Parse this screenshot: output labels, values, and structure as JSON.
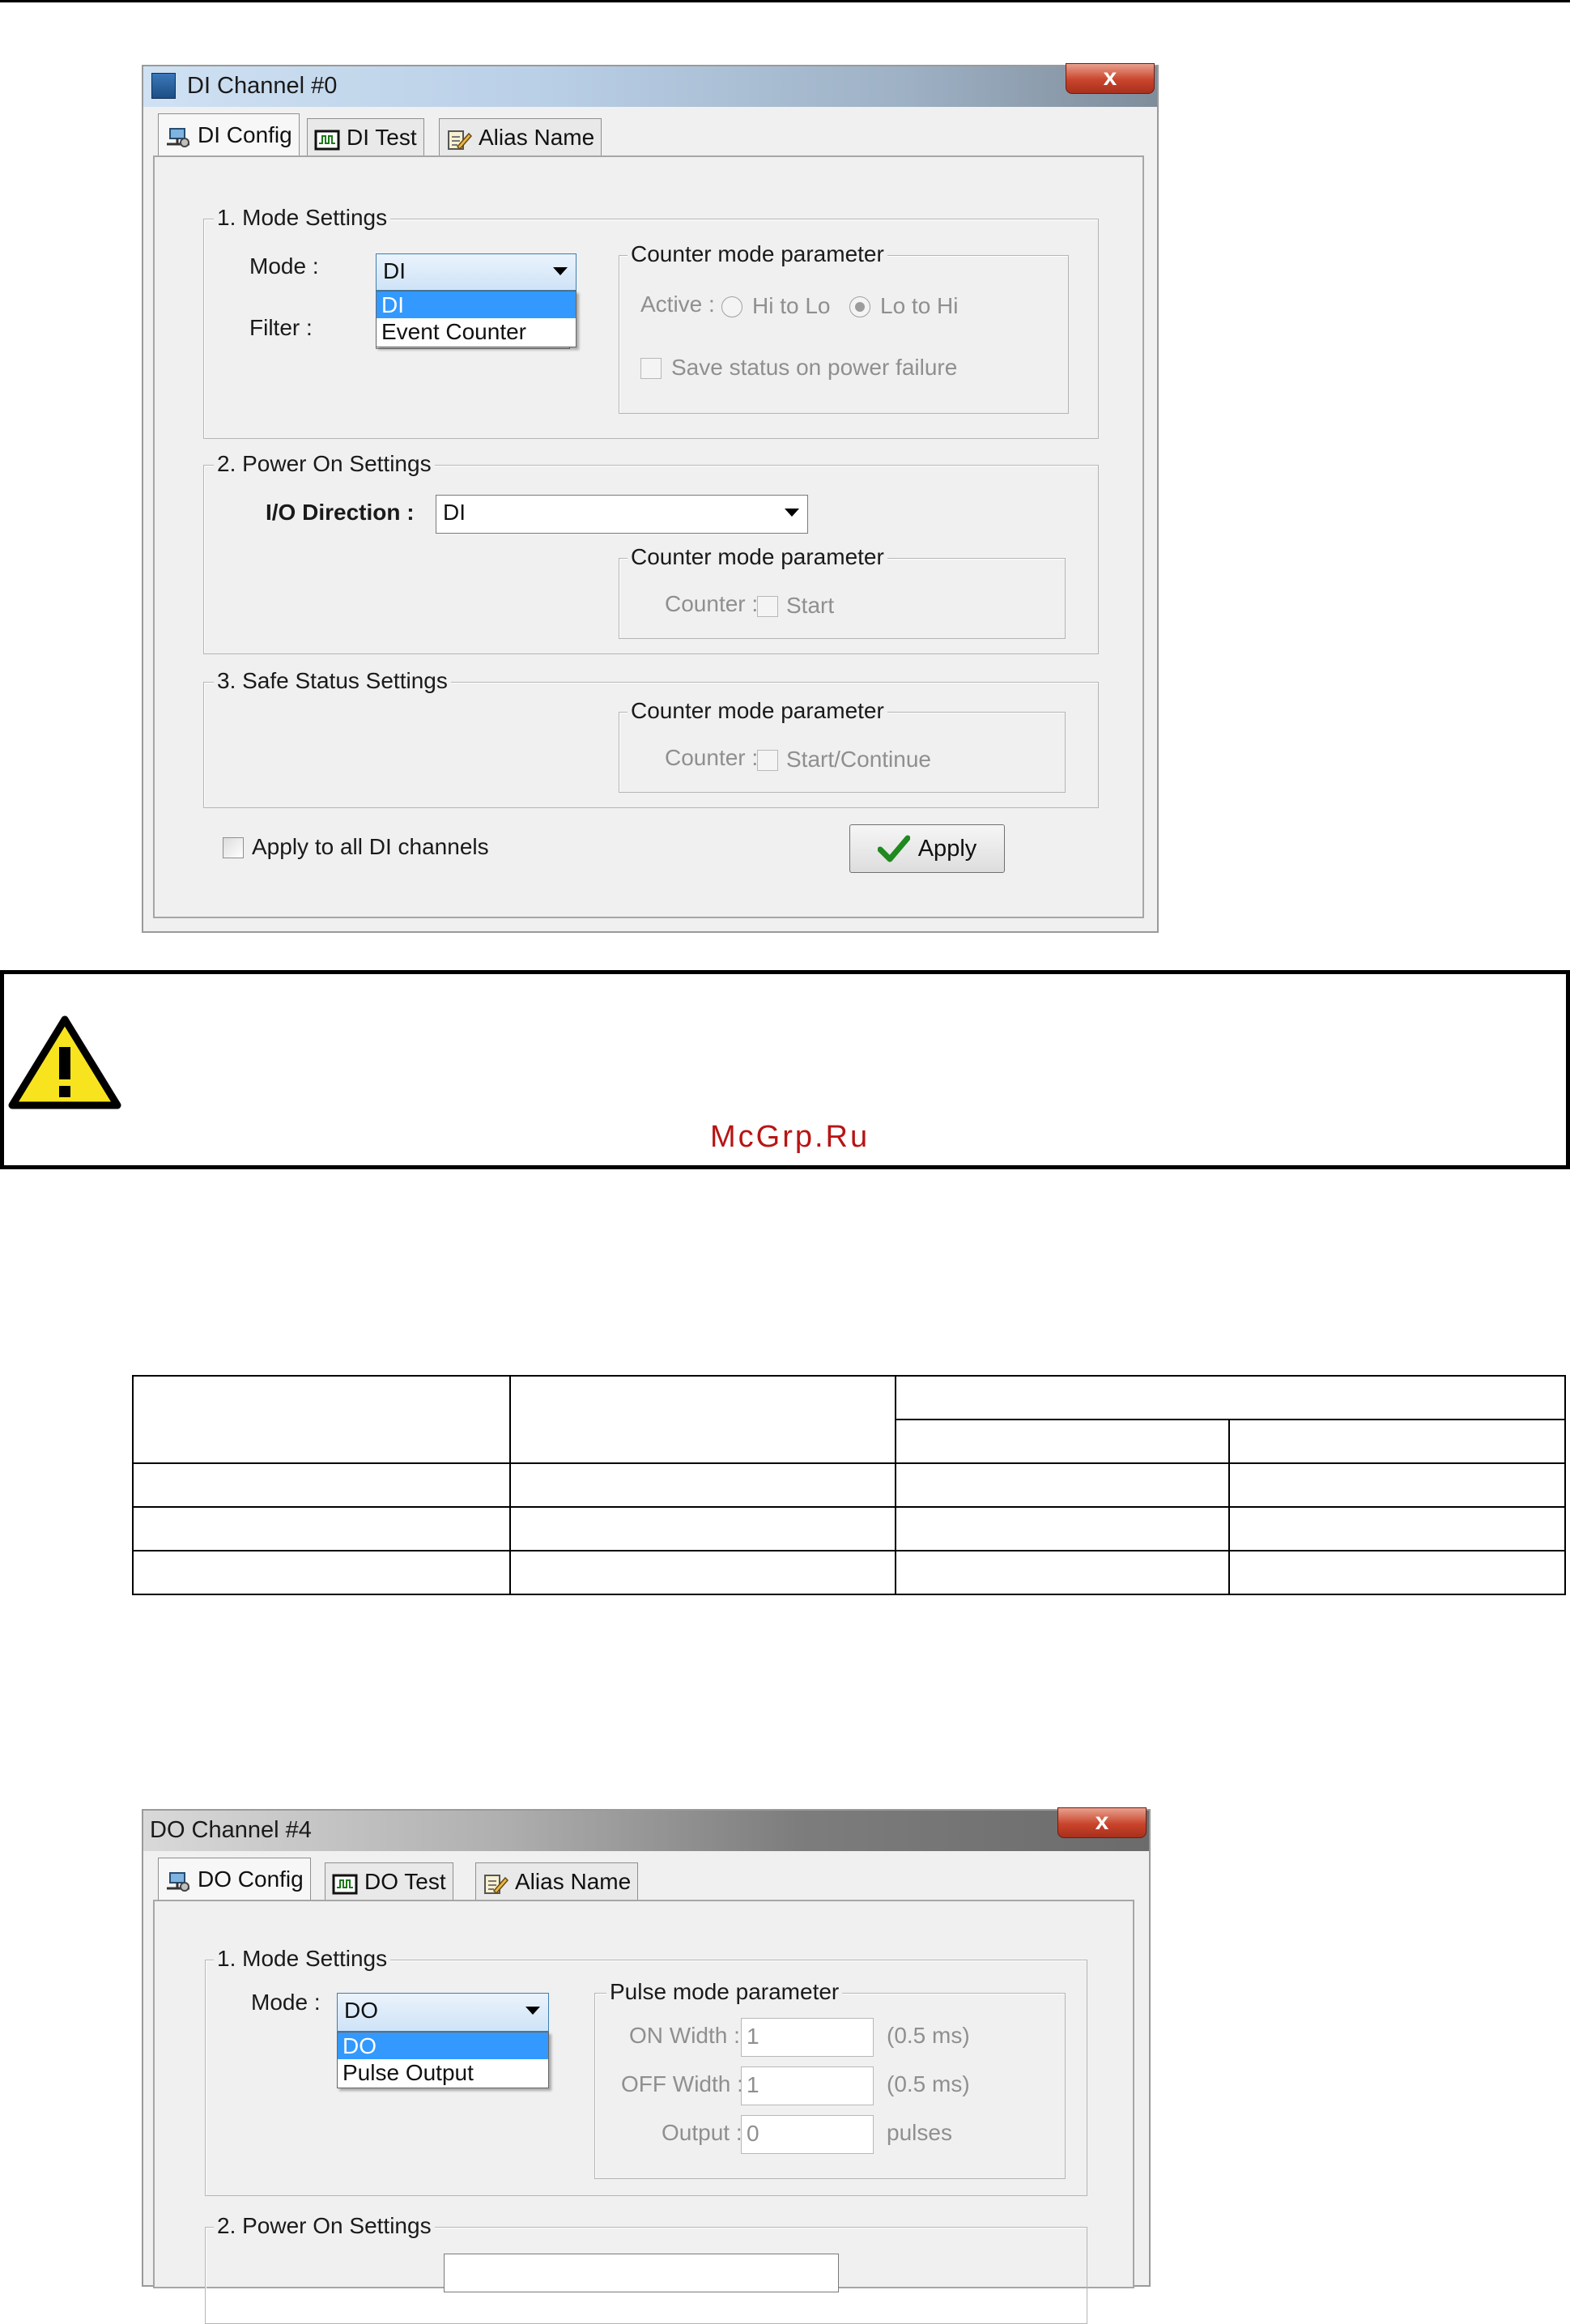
{
  "di_window": {
    "title": "DI Channel #0",
    "close_label": "x",
    "tabs": [
      {
        "label": "DI Config",
        "icon": "network-config-icon"
      },
      {
        "label": "DI Test",
        "icon": "oscilloscope-icon"
      },
      {
        "label": "Alias Name",
        "icon": "notepad-pencil-icon"
      }
    ],
    "mode_settings": {
      "legend": "1. Mode Settings",
      "mode_label": "Mode :",
      "mode_value": "DI",
      "mode_options": [
        "DI",
        "Event Counter"
      ],
      "filter_label": "Filter :",
      "counter_legend": "Counter mode parameter",
      "active_label": "Active :",
      "radio_hi_to_lo": "Hi to Lo",
      "radio_lo_to_hi": "Lo to Hi",
      "save_status": "Save status on power failure"
    },
    "power_on": {
      "legend": "2. Power On Settings",
      "io_direction_label": "I/O Direction :",
      "io_direction_value": "DI",
      "counter_legend": "Counter mode parameter",
      "counter_label": "Counter :",
      "start_label": "Start"
    },
    "safe_status": {
      "legend": "3. Safe Status Settings",
      "counter_legend": "Counter mode parameter",
      "counter_label": "Counter :",
      "start_continue_label": "Start/Continue"
    },
    "apply_all_label": "Apply to all DI channels",
    "apply_button": "Apply"
  },
  "warning": {
    "icon": "warning-triangle-icon",
    "watermark": "McGrp.Ru"
  },
  "do_window": {
    "title": "DO Channel #4",
    "close_label": "x",
    "tabs": [
      {
        "label": "DO Config",
        "icon": "network-config-icon"
      },
      {
        "label": "DO Test",
        "icon": "oscilloscope-icon"
      },
      {
        "label": "Alias Name",
        "icon": "notepad-pencil-icon"
      }
    ],
    "mode_settings": {
      "legend": "1. Mode Settings",
      "mode_label": "Mode :",
      "mode_value": "DO",
      "mode_options": [
        "DO",
        "Pulse Output"
      ],
      "pulse_legend": "Pulse mode parameter",
      "on_width_label": "ON Width :",
      "on_width_value": "1",
      "on_width_unit": "(0.5 ms)",
      "off_width_label": "OFF Width :",
      "off_width_value": "1",
      "off_width_unit": "(0.5 ms)",
      "output_label": "Output :",
      "output_value": "0",
      "output_unit": "pulses"
    },
    "power_on": {
      "legend": "2. Power On Settings"
    }
  },
  "colors": {
    "selection_blue": "#3399ff",
    "watermark_red": "#b81414",
    "close_red": "#c9442c"
  }
}
